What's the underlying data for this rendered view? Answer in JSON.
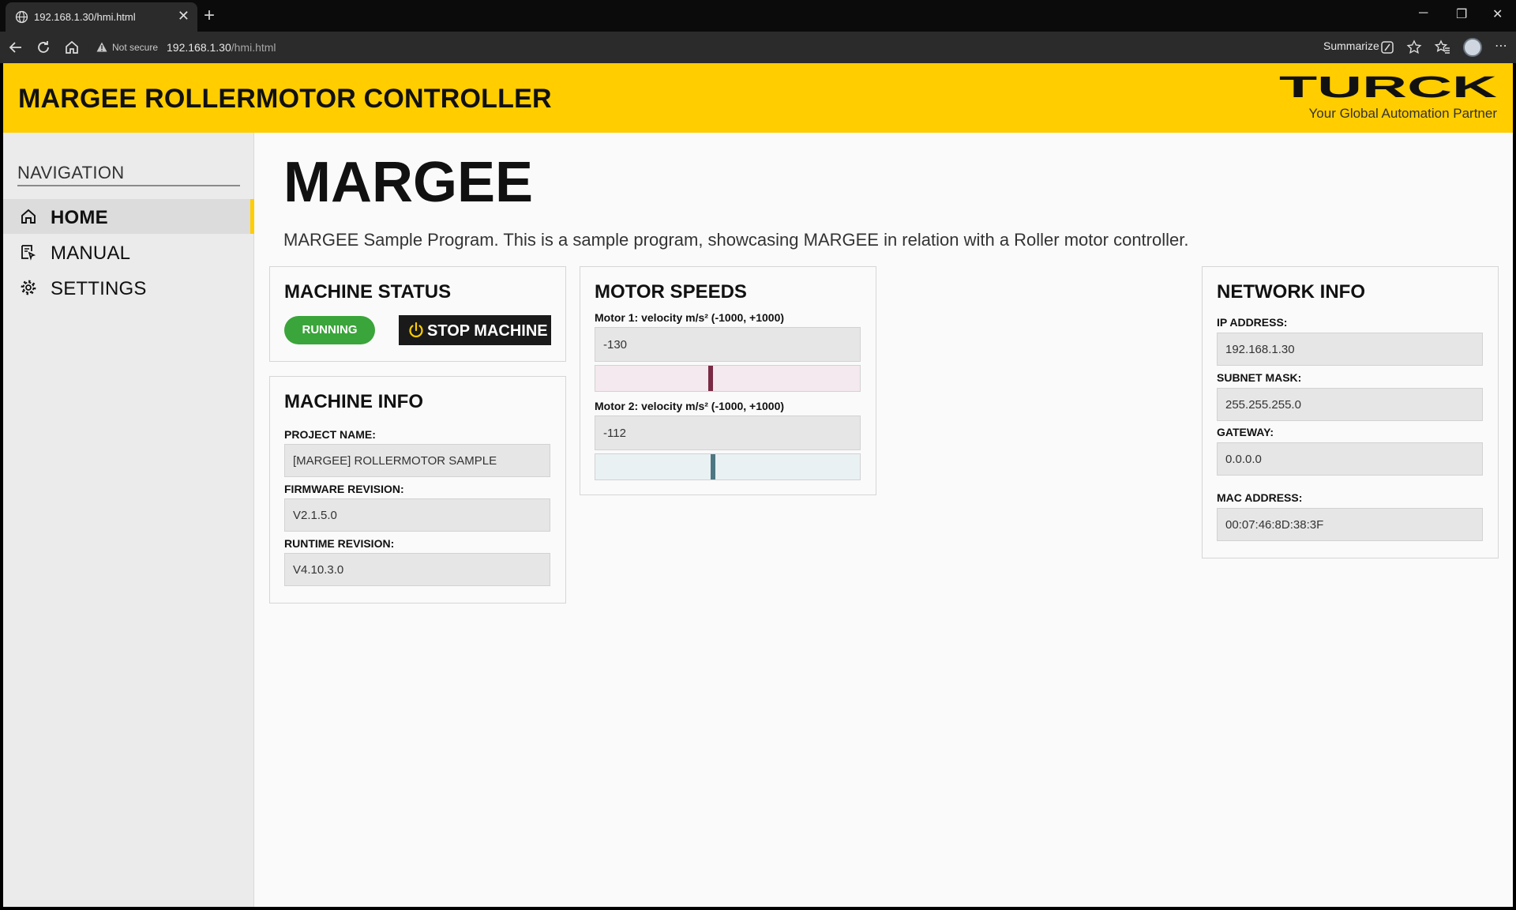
{
  "browser": {
    "tab_title": "192.168.1.30/hmi.html",
    "not_secure": "Not secure",
    "url_host": "192.168.1.30",
    "url_path": "/hmi.html",
    "summarize": "Summarize"
  },
  "header": {
    "title": "MARGEE ROLLERMOTOR CONTROLLER",
    "brand": "TURCK",
    "tagline": "Your Global Automation Partner"
  },
  "sidebar": {
    "heading": "NAVIGATION",
    "items": [
      {
        "label": "HOME",
        "icon": "home-icon",
        "active": true
      },
      {
        "label": "MANUAL",
        "icon": "manual-icon",
        "active": false
      },
      {
        "label": "SETTINGS",
        "icon": "gear-icon",
        "active": false
      }
    ]
  },
  "main": {
    "title": "MARGEE",
    "description": "MARGEE Sample Program. This is a sample program, showcasing MARGEE in relation with a Roller motor controller."
  },
  "machine_status": {
    "title": "MACHINE STATUS",
    "status": "RUNNING",
    "stop_label": "STOP MACHINE"
  },
  "machine_info": {
    "title": "MACHINE INFO",
    "fields": [
      {
        "label": "PROJECT NAME:",
        "value": "[MARGEE] ROLLERMOTOR SAMPLE"
      },
      {
        "label": "FIRMWARE REVISION:",
        "value": "V2.1.5.0"
      },
      {
        "label": "RUNTIME REVISION:",
        "value": "V4.10.3.0"
      }
    ]
  },
  "motor_speeds": {
    "title": "MOTOR SPEEDS",
    "motors": [
      {
        "label": "Motor 1: velocity m/s² (-1000, +1000)",
        "value": "-130",
        "min": -1000,
        "max": 1000,
        "level": -130
      },
      {
        "label": "Motor 2: velocity m/s² (-1000, +1000)",
        "value": "-112",
        "min": -1000,
        "max": 1000,
        "level": -112
      }
    ]
  },
  "network_info": {
    "title": "NETWORK INFO",
    "fields": [
      {
        "label": "IP ADDRESS:",
        "value": "192.168.1.30"
      },
      {
        "label": "SUBNET MASK:",
        "value": "255.255.255.0"
      },
      {
        "label": "GATEWAY:",
        "value": "0.0.0.0"
      },
      {
        "label": "MAC ADDRESS:",
        "value": "00:07:46:8D:38:3F"
      }
    ]
  },
  "colors": {
    "brand_yellow": "#ffcd00",
    "running_green": "#3aa53a",
    "motor1_marker": "#7a2a45",
    "motor1_track": "#f4e9ee",
    "motor2_marker": "#4d7782",
    "motor2_track": "#eaf1f3"
  }
}
